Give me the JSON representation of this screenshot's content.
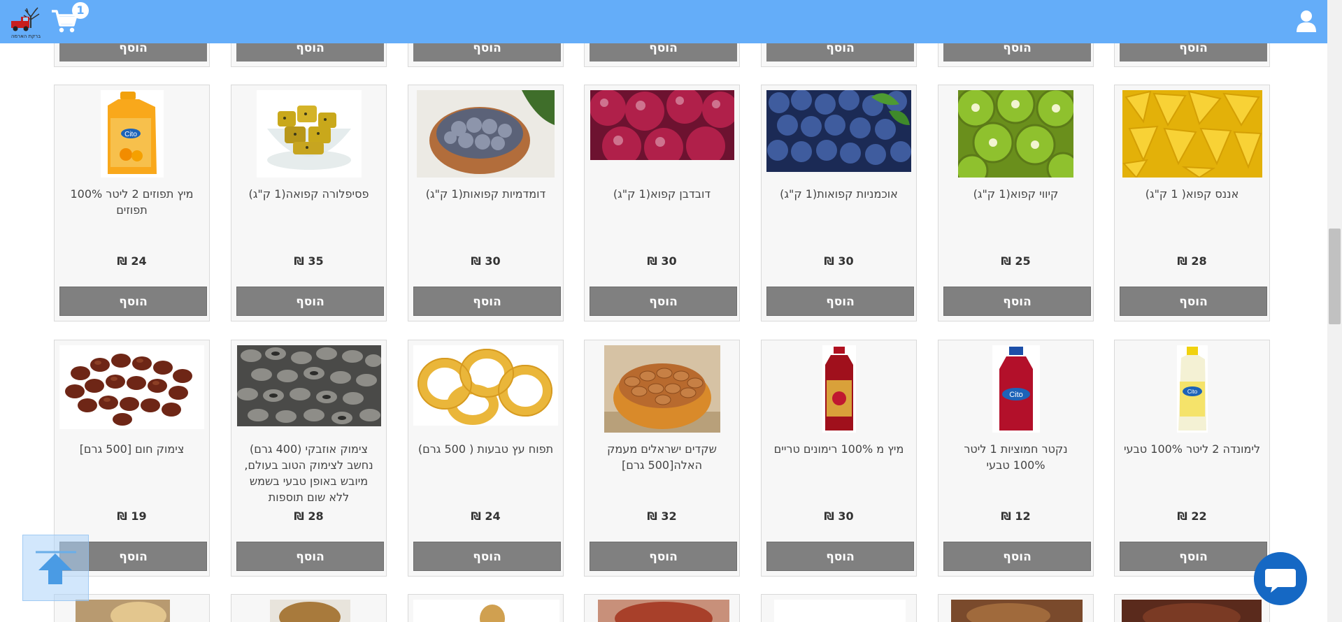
{
  "header": {
    "logo_text": "ברקת הארמה",
    "cart_count": "1"
  },
  "add_label": "הוסף",
  "row1": [
    {
      "name": "מיץ תפוזים 2 ליטר 100% תפוזים",
      "price": "24 ₪",
      "img": "orange-juice-bottle"
    },
    {
      "name": "פסיפלורה קפואה(1 ק\"ג)",
      "price": "35 ₪",
      "img": "frozen-passionfruit-bowl"
    },
    {
      "name": "דומדמיות קפואות(1 ק\"ג)",
      "price": "30 ₪",
      "img": "frozen-berries-bowl"
    },
    {
      "name": "דובדבן קפוא(1 ק\"ג)",
      "price": "30 ₪",
      "img": "frozen-cherries"
    },
    {
      "name": "אוכמניות קפואות(1 ק\"ג)",
      "price": "30 ₪",
      "img": "blueberries"
    },
    {
      "name": "קיווי קפוא(1 ק\"ג)",
      "price": "25 ₪",
      "img": "kiwi-slices"
    },
    {
      "name": "אננס קפוא( 1 ק\"ג)",
      "price": "28 ₪",
      "img": "pineapple-chunks"
    }
  ],
  "row2": [
    {
      "name": "צימוק חום [500 גרם]",
      "price": "19 ₪",
      "img": "brown-raisins"
    },
    {
      "name": "צימוק אוזבקי (400 גרם) נחשב לצימוק הטוב בעולם, מיובש באופן טבעי בשמש ללא שום תוספות",
      "price": "28 ₪",
      "img": "uzbek-raisins"
    },
    {
      "name": "תפוח עץ טבעות ( 500 גרם)",
      "price": "24 ₪",
      "img": "dried-apple-rings"
    },
    {
      "name": "שקדים ישראלים מעמק האלה[500 גרם]",
      "price": "32 ₪",
      "img": "almonds-bowl"
    },
    {
      "name": "מיץ מ 100% רימונים טריים",
      "price": "30 ₪",
      "img": "pomegranate-juice-bottle"
    },
    {
      "name": "נקטר חמוציות 1 ליטר 100% טבעי",
      "price": "12 ₪",
      "img": "cranberry-nectar-bottle"
    },
    {
      "name": "לימונדה 2 ליטר 100% טבעי",
      "price": "22 ₪",
      "img": "lemonade-bottle"
    }
  ]
}
